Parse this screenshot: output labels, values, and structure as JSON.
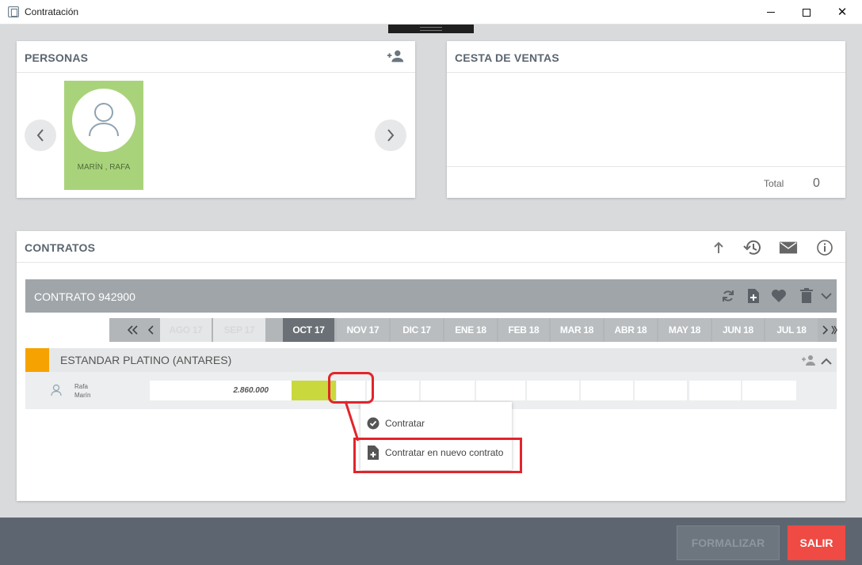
{
  "window": {
    "title": "Contratación",
    "icons": [
      "app-icon",
      "minimize-icon",
      "maximize-icon",
      "close-icon"
    ]
  },
  "personas": {
    "title": "PERSONAS",
    "add_icon": "add-person-icon",
    "person": {
      "name": "MARÍN , RAFA",
      "card_color": "#a9d37a"
    }
  },
  "cesta": {
    "title": "CESTA DE VENTAS",
    "total_label": "Total",
    "total_value": "0"
  },
  "contratos": {
    "title": "CONTRATOS",
    "tool_icons": [
      "arrow-up-icon",
      "history-icon",
      "mail-icon",
      "info-icon"
    ],
    "contract": {
      "label": "CONTRATO 942900",
      "icons": [
        "refresh-icon",
        "add-document-icon",
        "heart-icon",
        "trash-icon",
        "chevron-down-icon"
      ]
    },
    "months": [
      "AGO 17",
      "SEP 17",
      "OCT 17",
      "NOV 17",
      "DIC 17",
      "ENE 18",
      "FEB 18",
      "MAR 18",
      "ABR 18",
      "MAY 18",
      "JUN 18",
      "JUL 18"
    ],
    "active_month": "OCT 17",
    "product": {
      "label": "ESTANDAR PLATINO (ANTARES)",
      "swatch_color": "#f6a200"
    },
    "row": {
      "first_name": "Rafa",
      "last_name": "Marín",
      "amount": "2.860.000"
    }
  },
  "context_menu": {
    "items": [
      {
        "label": "Contratar",
        "icon": "check-circle-icon"
      },
      {
        "label": "Contratar en nuevo contrato",
        "icon": "new-document-icon"
      }
    ]
  },
  "footer": {
    "formalizar_label": "FORMALIZAR",
    "salir_label": "SALIR",
    "salir_color": "#ef4a44"
  }
}
